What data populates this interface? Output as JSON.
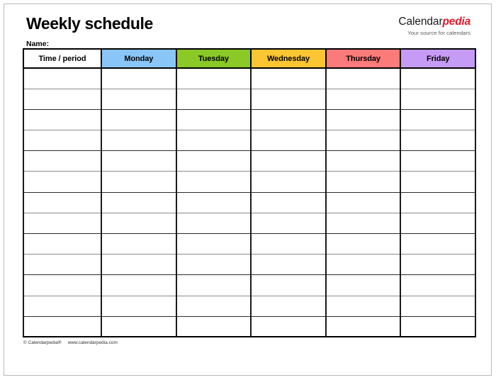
{
  "document": {
    "title": "Weekly schedule",
    "name_label": "Name:"
  },
  "brand": {
    "word_primary": "Calendar",
    "word_accent": "pedia",
    "tagline": "Your source for calendars",
    "accent_color": "#e8152a",
    "primary_color": "#1a1a1a"
  },
  "table": {
    "columns": [
      {
        "key": "time",
        "label": "Time / period",
        "color": "#ffffff"
      },
      {
        "key": "monday",
        "label": "Monday",
        "color": "#89c6f7"
      },
      {
        "key": "tuesday",
        "label": "Tuesday",
        "color": "#8ac926"
      },
      {
        "key": "wednesday",
        "label": "Wednesday",
        "color": "#fcc633"
      },
      {
        "key": "thursday",
        "label": "Thursday",
        "color": "#fb7a7a"
      },
      {
        "key": "friday",
        "label": "Friday",
        "color": "#c69bf5"
      }
    ],
    "row_count": 13,
    "rows": [
      {
        "time": "",
        "monday": "",
        "tuesday": "",
        "wednesday": "",
        "thursday": "",
        "friday": ""
      },
      {
        "time": "",
        "monday": "",
        "tuesday": "",
        "wednesday": "",
        "thursday": "",
        "friday": ""
      },
      {
        "time": "",
        "monday": "",
        "tuesday": "",
        "wednesday": "",
        "thursday": "",
        "friday": ""
      },
      {
        "time": "",
        "monday": "",
        "tuesday": "",
        "wednesday": "",
        "thursday": "",
        "friday": ""
      },
      {
        "time": "",
        "monday": "",
        "tuesday": "",
        "wednesday": "",
        "thursday": "",
        "friday": ""
      },
      {
        "time": "",
        "monday": "",
        "tuesday": "",
        "wednesday": "",
        "thursday": "",
        "friday": ""
      },
      {
        "time": "",
        "monday": "",
        "tuesday": "",
        "wednesday": "",
        "thursday": "",
        "friday": ""
      },
      {
        "time": "",
        "monday": "",
        "tuesday": "",
        "wednesday": "",
        "thursday": "",
        "friday": ""
      },
      {
        "time": "",
        "monday": "",
        "tuesday": "",
        "wednesday": "",
        "thursday": "",
        "friday": ""
      },
      {
        "time": "",
        "monday": "",
        "tuesday": "",
        "wednesday": "",
        "thursday": "",
        "friday": ""
      },
      {
        "time": "",
        "monday": "",
        "tuesday": "",
        "wednesday": "",
        "thursday": "",
        "friday": ""
      },
      {
        "time": "",
        "monday": "",
        "tuesday": "",
        "wednesday": "",
        "thursday": "",
        "friday": ""
      },
      {
        "time": "",
        "monday": "",
        "tuesday": "",
        "wednesday": "",
        "thursday": "",
        "friday": ""
      }
    ]
  },
  "footer": {
    "copyright": "© Calendarpedia®",
    "website": "www.calendarpedia.com"
  }
}
